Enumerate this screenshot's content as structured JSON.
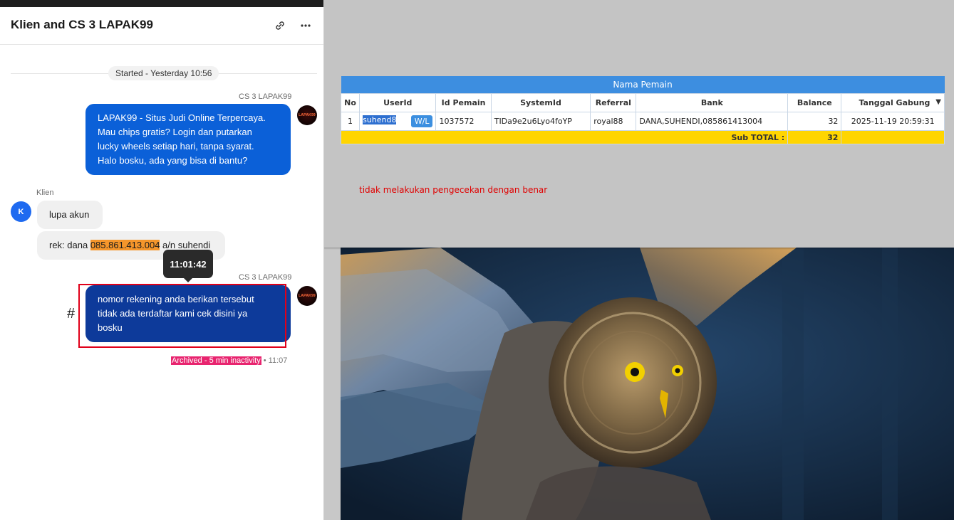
{
  "chat": {
    "title": "Klien and CS 3 LAPAK99",
    "started": "Started - Yesterday 10:56",
    "avatar_label": "LAPAK99",
    "messages": [
      {
        "sender": "CS 3 LAPAK99",
        "lines": [
          "LAPAK99 - Situs Judi Online Terpercaya.",
          "Mau chips gratis? Login dan putarkan",
          "lucky wheels setiap hari, tanpa syarat.",
          "Halo bosku, ada yang bisa di bantu?"
        ]
      },
      {
        "sender": "Klien",
        "avatar": "K",
        "text": "lupa akun"
      },
      {
        "rek_prefix": "rek: dana ",
        "rek_number": "085.861.413.004",
        "rek_suffix": " a/n suhendi"
      },
      {
        "sender": "CS 3 LAPAK99",
        "tooltip": "11:01:42",
        "lines": [
          "nomor rekening anda berikan tersebut",
          "tidak ada terdaftar kami cek disini ya",
          "bosku"
        ]
      }
    ],
    "hash": "#",
    "archived_label": "Archived - 5 min inactivity",
    "archived_time": " • 11:07"
  },
  "panel": {
    "caption": "Nama Pemain",
    "headers": [
      "No",
      "UserId",
      "Id Pemain",
      "SystemId",
      "Referral",
      "Bank",
      "Balance",
      "Tanggal Gabung"
    ],
    "row": {
      "no": "1",
      "userid": "suhend8",
      "wl": "W/L",
      "id_pemain": "1037572",
      "systemid": "TIDa9e2u6Lyo4foYP",
      "referral": "royal88",
      "bank": "DANA,SUHENDI,085861413004",
      "balance": "32",
      "tanggal": "2025-11-19 20:59:31"
    },
    "subtotal_label": "Sub TOTAL :",
    "subtotal_value": "32",
    "note": "tidak melakukan pengecekan dengan benar"
  },
  "colors": {
    "cs_bubble": "#0b60d8",
    "cs_bubble_dark": "#0d3a9a",
    "table_header": "#3d8ee0",
    "subtotal": "#ffd500",
    "archived": "#e8246f",
    "note": "#e00000"
  },
  "icons": [
    "link-icon",
    "more-icon",
    "lapak99-avatar-icon"
  ]
}
